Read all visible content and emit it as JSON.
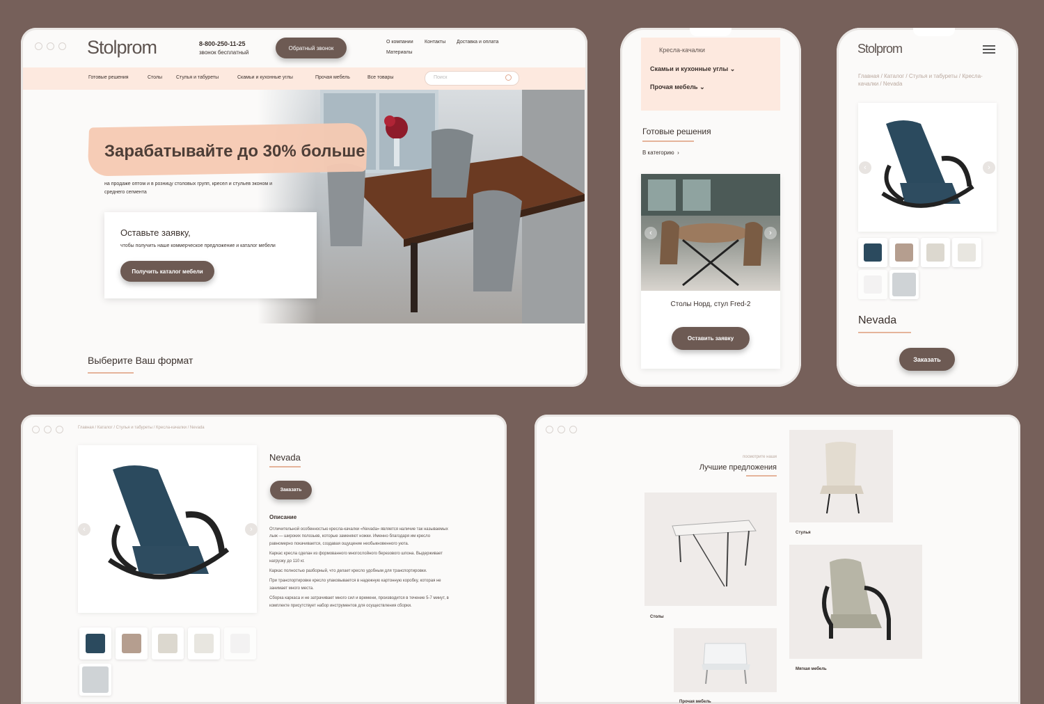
{
  "desktop": {
    "logo": "Stolprom",
    "phone": "8-800-250-11-25",
    "phone_note": "звонок бесплатный",
    "callback_button": "Обратный звонок",
    "top_links": [
      "О компании",
      "Контакты",
      "Доставка и оплата",
      "Материалы"
    ],
    "nav": [
      "Готовые решения",
      "Столы",
      "Стулья и табуреты",
      "Скамьи и кухонные углы",
      "Прочая мебель",
      "Все товары"
    ],
    "search_placeholder": "Поиск",
    "hero_title": "Зарабатывайте до 30% больше",
    "hero_sub": "на продаже оптом и в розницу столовых групп, кресел и стульев эконом и среднего сегмента",
    "form_title": "Оставьте заявку,",
    "form_sub": "чтобы получить наше коммерческое предложение и каталог мебели",
    "form_button": "Получить каталог мебели",
    "section_title": "Выберите Ваш формат"
  },
  "phone1": {
    "menu_cut": "Кресла-качалки",
    "menu_items": [
      "Скамьи и кухонные углы",
      "Прочая мебель"
    ],
    "section_title": "Готовые решения",
    "category_link": "В категорию",
    "product_caption": "Столы Норд, стул Fred-2",
    "button": "Оставить заявку"
  },
  "phone2": {
    "logo": "Stolprom",
    "breadcrumb": "Главная / Каталог / Стулья и табуреты / Кресла-качалки / Nevada",
    "product_title": "Nevada",
    "button": "Заказать"
  },
  "product_page": {
    "breadcrumb": "Главная / Каталог / Стулья и табуреты / Кресла-качалки / Nevada",
    "title": "Nevada",
    "button": "Заказать",
    "desc_title": "Описание",
    "paragraphs": [
      "Отличительной особенностью кресла-качалки «Nevada» является наличие так называемых лыж — широких полозьев, которые заменяют ножки. Именно благодаря им кресло равномерно покачивается, создавая ощущение необыкновенного уюта.",
      "Каркас кресла сделан из формованного многослойного березового шпона. Выдерживает нагрузку до 110 кг.",
      "Каркас полностью разборный, что делает кресло удобным для транспортировки.",
      "При транспортировке кресло упаковывается в надежную картонную коробку, которая не занимает много места.",
      "Сборка каркаса и не затрачивает много сил и времени, производится в течение 5-7 минут, в комплекте присутствует набор инструментов для осуществления сборки."
    ]
  },
  "offers_page": {
    "kicker": "посмотрите наши",
    "title": "Лучшие предложения",
    "cards": [
      "Стулья",
      "Столы",
      "Мягкая мебель",
      "Прочая мебель"
    ]
  },
  "colors": {
    "background": "#76605a",
    "accent": "#6d5a53",
    "peach": "#fde9df",
    "underline": "#e5b39a"
  }
}
